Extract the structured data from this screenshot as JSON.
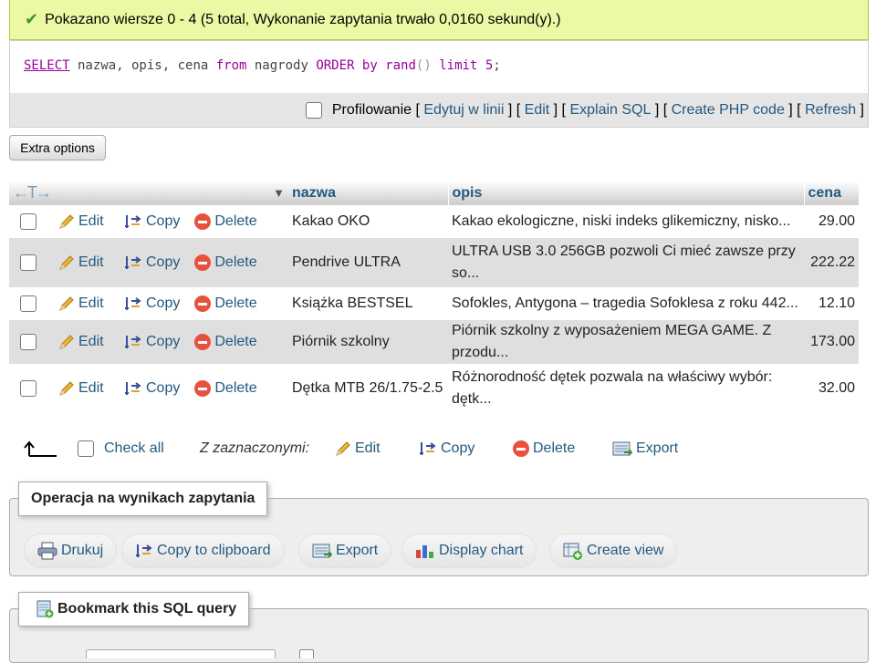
{
  "banner": {
    "message": "Pokazano wiersze 0 - 4 (5 total, Wykonanie zapytania trwało 0,0160 sekund(y).)"
  },
  "sql": {
    "select": "SELECT",
    "cols": " nazwa, opis, cena ",
    "from": "from",
    "table": " nagrody ",
    "order": "ORDER",
    "by": "by",
    "rand": "rand",
    "parens": "()",
    "limit": "limit",
    "num": "5",
    "semicolon": ";"
  },
  "tools": {
    "profiling": "Profilowanie",
    "inline_edit": "Edytuj w linii",
    "edit": "Edit",
    "explain": "Explain SQL",
    "php": "Create PHP code",
    "refresh": "Refresh"
  },
  "extra_options": "Extra options",
  "table": {
    "headers": {
      "arrows": "←T→",
      "nazwa": "nazwa",
      "opis": "opis",
      "cena": "cena"
    },
    "actions": {
      "edit": "Edit",
      "copy": "Copy",
      "delete": "Delete"
    },
    "rows": [
      {
        "nazwa": "Kakao OKO",
        "opis": "Kakao ekologiczne, niski indeks glikemiczny, nisko...",
        "cena": "29.00"
      },
      {
        "nazwa": "Pendrive ULTRA",
        "opis": "ULTRA USB 3.0 256GB pozwoli Ci mieć zawsze przy so...",
        "cena": "222.22"
      },
      {
        "nazwa": "Książka BESTSEL",
        "opis": "Sofokles, Antygona – tragedia Sofoklesa z roku 442...",
        "cena": "12.10"
      },
      {
        "nazwa": "Piórnik szkolny",
        "opis": "Piórnik szkolny z wyposażeniem MEGA GAME. Z przodu...",
        "cena": "173.00"
      },
      {
        "nazwa": "Dętka MTB 26/1.75-2.5",
        "opis": "Różnorodność dętek pozwala na właściwy wybór: dętk...",
        "cena": "32.00"
      }
    ]
  },
  "multi": {
    "check_all": "Check all",
    "with_selected": "Z zaznaczonymi:",
    "edit": "Edit",
    "copy": "Copy",
    "delete": "Delete",
    "export": "Export"
  },
  "operations": {
    "legend": "Operacja na wynikach zapytania",
    "print": "Drukuj",
    "clipboard": "Copy to clipboard",
    "export": "Export",
    "chart": "Display chart",
    "view": "Create view"
  },
  "bookmark": {
    "legend": "Bookmark this SQL query"
  }
}
